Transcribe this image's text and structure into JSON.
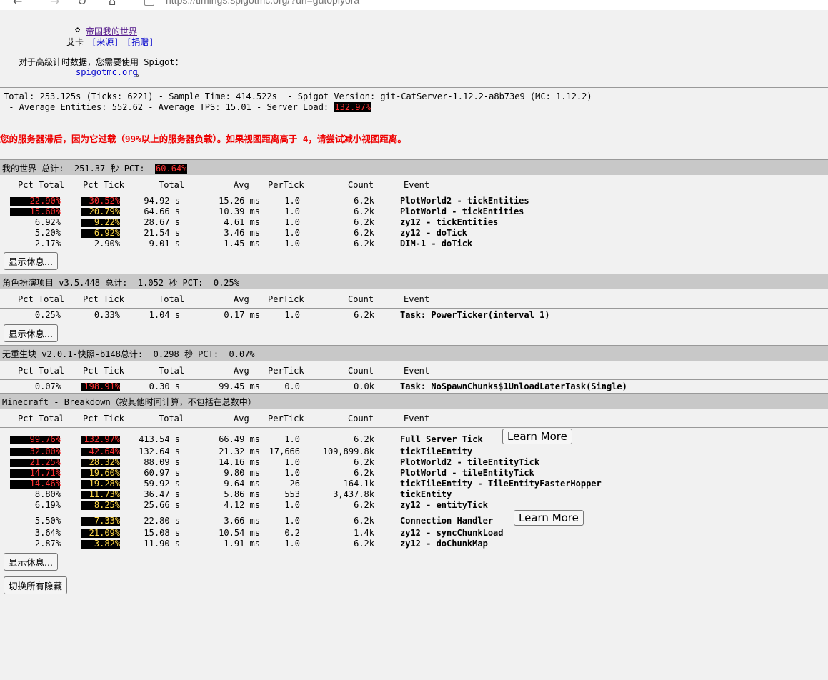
{
  "browser": {
    "url": "https://timings.spigotmc.org/?url=gutoplyora"
  },
  "header": {
    "line1": "帝国我的世界",
    "author_prefix": "艾卡",
    "source_link": "[来源]",
    "donate_link": "[捐赠]",
    "note": "对于高级计时数据，您需要使用 Spigot：",
    "spigot_link": "spigotmc.org",
    "spigot_suffix": "。"
  },
  "summary": {
    "line1": "Total: 253.125s (Ticks: 6221) - Sample Time: 414.522s  - Spigot Version: git-CatServer-1.12.2-a8b73e9 (MC: 1.12.2)",
    "line2": " - Average Entities: 552.62 - Average TPS: 15.01 - Server Load: ",
    "server_load": "132.97%"
  },
  "warning": "您的服务器滞后，因为它过载（99%以上的服务器负载）。如果视图距离高于 4，请尝试减小视图距离。",
  "columns": {
    "pct_total": "Pct Total",
    "pct_tick": "Pct Tick",
    "total": "Total",
    "avg": "Avg",
    "pertick": "PerTick",
    "count": "Count",
    "event": "Event"
  },
  "sections": [
    {
      "title": "我的世界 总计:  251.37 秒 PCT:  ",
      "pct": "60.64%",
      "rows": [
        {
          "pct_total": "22.90%",
          "pt_bar": 0.23,
          "pct_tick": "30.52%",
          "pk_bar": 0.31,
          "total": "94.92 s",
          "avg": "15.26 ms",
          "pertick": "1.0",
          "count": "6.2k",
          "event": "PlotWorld2 - tickEntities"
        },
        {
          "pct_total": "15.60%",
          "pt_bar": 0.16,
          "pct_tick": "20.79%",
          "pk_bar": 0.21,
          "total": "64.66 s",
          "avg": "10.39 ms",
          "pertick": "1.0",
          "count": "6.2k",
          "event": "PlotWorld - tickEntities"
        },
        {
          "pct_total": "6.92%",
          "pt_bar": 0,
          "pct_tick": "9.22%",
          "pk_bar": 0.09,
          "total": "28.67 s",
          "avg": "4.61 ms",
          "pertick": "1.0",
          "count": "6.2k",
          "event": "zy12 - tickEntities"
        },
        {
          "pct_total": "5.20%",
          "pt_bar": 0,
          "pct_tick": "6.92%",
          "pk_bar": 0.07,
          "total": "21.54 s",
          "avg": "3.46 ms",
          "pertick": "1.0",
          "count": "6.2k",
          "event": "zy12 - doTick"
        },
        {
          "pct_total": "2.17%",
          "pt_bar": 0,
          "pct_tick": "2.90%",
          "pk_bar": 0,
          "total": "9.01 s",
          "avg": "1.45 ms",
          "pertick": "1.0",
          "count": "6.2k",
          "event": "DIM-1 - doTick"
        }
      ]
    },
    {
      "title": "角色扮演项目 v3.5.448 总计:  1.052 秒 PCT:  0.25%",
      "pct": "",
      "rows": [
        {
          "pct_total": "0.25%",
          "pt_bar": 0,
          "pct_tick": "0.33%",
          "pk_bar": 0,
          "total": "1.04 s",
          "avg": "0.17 ms",
          "pertick": "1.0",
          "count": "6.2k",
          "event": "Task: PowerTicker(interval 1)"
        }
      ]
    },
    {
      "title": "无重生块 v2.0.1-快照-b148总计:  0.298 秒 PCT:  0.07%",
      "pct": "",
      "rows": [
        {
          "pct_total": "0.07%",
          "pt_bar": 0,
          "pct_tick": "198.91%",
          "pk_bar": 1.0,
          "total": "0.30 s",
          "avg": "99.45 ms",
          "pertick": "0.0",
          "count": "0.0k",
          "event": "Task: NoSpawnChunks$1UnloadLaterTask(Single)"
        }
      ]
    },
    {
      "title": "Minecraft - Breakdown（按其他时间计算，不包括在总数中）",
      "pct": "",
      "rows": [
        {
          "pct_total": "99.76%",
          "pt_bar": 1.0,
          "pct_tick": "132.97%",
          "pk_bar": 1.0,
          "total": "413.54 s",
          "avg": "66.49 ms",
          "pertick": "1.0",
          "count": "6.2k",
          "event": "Full Server Tick",
          "learn": "Learn More"
        },
        {
          "pct_total": "32.00%",
          "pt_bar": 0.32,
          "pct_tick": "42.64%",
          "pk_bar": 0.43,
          "total": "132.64 s",
          "avg": "21.32 ms",
          "pertick": "17,666",
          "count": "109,899.8k",
          "event": "tickTileEntity"
        },
        {
          "pct_total": "21.25%",
          "pt_bar": 0.21,
          "pct_tick": "28.32%",
          "pk_bar": 0.28,
          "total": "88.09 s",
          "avg": "14.16 ms",
          "pertick": "1.0",
          "count": "6.2k",
          "event": "PlotWorld2 - tileEntityTick"
        },
        {
          "pct_total": "14.71%",
          "pt_bar": 0.15,
          "pct_tick": "19.60%",
          "pk_bar": 0.2,
          "total": "60.97 s",
          "avg": "9.80 ms",
          "pertick": "1.0",
          "count": "6.2k",
          "event": "PlotWorld - tileEntityTick"
        },
        {
          "pct_total": "14.46%",
          "pt_bar": 0.14,
          "pct_tick": "19.28%",
          "pk_bar": 0.19,
          "total": "59.92 s",
          "avg": "9.64 ms",
          "pertick": "26",
          "count": "164.1k",
          "event": "tickTileEntity - TileEntityFasterHopper"
        },
        {
          "pct_total": "8.80%",
          "pt_bar": 0,
          "pct_tick": "11.73%",
          "pk_bar": 0.12,
          "total": "36.47 s",
          "avg": "5.86 ms",
          "pertick": "553",
          "count": "3,437.8k",
          "event": "tickEntity"
        },
        {
          "pct_total": "6.19%",
          "pt_bar": 0,
          "pct_tick": "8.25%",
          "pk_bar": 0.08,
          "total": "25.66 s",
          "avg": "4.12 ms",
          "pertick": "1.0",
          "count": "6.2k",
          "event": "zy12 - entityTick"
        },
        {
          "pct_total": "5.50%",
          "pt_bar": 0,
          "pct_tick": "7.33%",
          "pk_bar": 0.07,
          "total": "22.80 s",
          "avg": "3.66 ms",
          "pertick": "1.0",
          "count": "6.2k",
          "event": "Connection Handler",
          "learn": "Learn More"
        },
        {
          "pct_total": "3.64%",
          "pt_bar": 0,
          "pct_tick": "21.09%",
          "pk_bar": 0.21,
          "total": "15.08 s",
          "avg": "10.54 ms",
          "pertick": "0.2",
          "count": "1.4k",
          "event": "zy12 - syncChunkLoad"
        },
        {
          "pct_total": "2.87%",
          "pt_bar": 0,
          "pct_tick": "3.82%",
          "pk_bar": 0.04,
          "total": "11.90 s",
          "avg": "1.91 ms",
          "pertick": "1.0",
          "count": "6.2k",
          "event": "zy12 - doChunkMap"
        }
      ]
    }
  ],
  "buttons": {
    "show_rest": "显示休息...",
    "toggle_all": "切换所有隐藏"
  }
}
